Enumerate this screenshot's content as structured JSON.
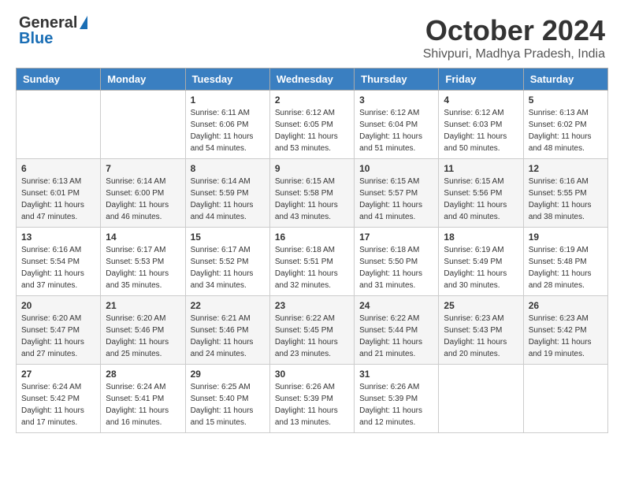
{
  "header": {
    "logo_general": "General",
    "logo_blue": "Blue",
    "month_title": "October 2024",
    "location": "Shivpuri, Madhya Pradesh, India"
  },
  "weekdays": [
    "Sunday",
    "Monday",
    "Tuesday",
    "Wednesday",
    "Thursday",
    "Friday",
    "Saturday"
  ],
  "weeks": [
    [
      {
        "day": "",
        "info": ""
      },
      {
        "day": "",
        "info": ""
      },
      {
        "day": "1",
        "info": "Sunrise: 6:11 AM\nSunset: 6:06 PM\nDaylight: 11 hours and 54 minutes."
      },
      {
        "day": "2",
        "info": "Sunrise: 6:12 AM\nSunset: 6:05 PM\nDaylight: 11 hours and 53 minutes."
      },
      {
        "day": "3",
        "info": "Sunrise: 6:12 AM\nSunset: 6:04 PM\nDaylight: 11 hours and 51 minutes."
      },
      {
        "day": "4",
        "info": "Sunrise: 6:12 AM\nSunset: 6:03 PM\nDaylight: 11 hours and 50 minutes."
      },
      {
        "day": "5",
        "info": "Sunrise: 6:13 AM\nSunset: 6:02 PM\nDaylight: 11 hours and 48 minutes."
      }
    ],
    [
      {
        "day": "6",
        "info": "Sunrise: 6:13 AM\nSunset: 6:01 PM\nDaylight: 11 hours and 47 minutes."
      },
      {
        "day": "7",
        "info": "Sunrise: 6:14 AM\nSunset: 6:00 PM\nDaylight: 11 hours and 46 minutes."
      },
      {
        "day": "8",
        "info": "Sunrise: 6:14 AM\nSunset: 5:59 PM\nDaylight: 11 hours and 44 minutes."
      },
      {
        "day": "9",
        "info": "Sunrise: 6:15 AM\nSunset: 5:58 PM\nDaylight: 11 hours and 43 minutes."
      },
      {
        "day": "10",
        "info": "Sunrise: 6:15 AM\nSunset: 5:57 PM\nDaylight: 11 hours and 41 minutes."
      },
      {
        "day": "11",
        "info": "Sunrise: 6:15 AM\nSunset: 5:56 PM\nDaylight: 11 hours and 40 minutes."
      },
      {
        "day": "12",
        "info": "Sunrise: 6:16 AM\nSunset: 5:55 PM\nDaylight: 11 hours and 38 minutes."
      }
    ],
    [
      {
        "day": "13",
        "info": "Sunrise: 6:16 AM\nSunset: 5:54 PM\nDaylight: 11 hours and 37 minutes."
      },
      {
        "day": "14",
        "info": "Sunrise: 6:17 AM\nSunset: 5:53 PM\nDaylight: 11 hours and 35 minutes."
      },
      {
        "day": "15",
        "info": "Sunrise: 6:17 AM\nSunset: 5:52 PM\nDaylight: 11 hours and 34 minutes."
      },
      {
        "day": "16",
        "info": "Sunrise: 6:18 AM\nSunset: 5:51 PM\nDaylight: 11 hours and 32 minutes."
      },
      {
        "day": "17",
        "info": "Sunrise: 6:18 AM\nSunset: 5:50 PM\nDaylight: 11 hours and 31 minutes."
      },
      {
        "day": "18",
        "info": "Sunrise: 6:19 AM\nSunset: 5:49 PM\nDaylight: 11 hours and 30 minutes."
      },
      {
        "day": "19",
        "info": "Sunrise: 6:19 AM\nSunset: 5:48 PM\nDaylight: 11 hours and 28 minutes."
      }
    ],
    [
      {
        "day": "20",
        "info": "Sunrise: 6:20 AM\nSunset: 5:47 PM\nDaylight: 11 hours and 27 minutes."
      },
      {
        "day": "21",
        "info": "Sunrise: 6:20 AM\nSunset: 5:46 PM\nDaylight: 11 hours and 25 minutes."
      },
      {
        "day": "22",
        "info": "Sunrise: 6:21 AM\nSunset: 5:46 PM\nDaylight: 11 hours and 24 minutes."
      },
      {
        "day": "23",
        "info": "Sunrise: 6:22 AM\nSunset: 5:45 PM\nDaylight: 11 hours and 23 minutes."
      },
      {
        "day": "24",
        "info": "Sunrise: 6:22 AM\nSunset: 5:44 PM\nDaylight: 11 hours and 21 minutes."
      },
      {
        "day": "25",
        "info": "Sunrise: 6:23 AM\nSunset: 5:43 PM\nDaylight: 11 hours and 20 minutes."
      },
      {
        "day": "26",
        "info": "Sunrise: 6:23 AM\nSunset: 5:42 PM\nDaylight: 11 hours and 19 minutes."
      }
    ],
    [
      {
        "day": "27",
        "info": "Sunrise: 6:24 AM\nSunset: 5:42 PM\nDaylight: 11 hours and 17 minutes."
      },
      {
        "day": "28",
        "info": "Sunrise: 6:24 AM\nSunset: 5:41 PM\nDaylight: 11 hours and 16 minutes."
      },
      {
        "day": "29",
        "info": "Sunrise: 6:25 AM\nSunset: 5:40 PM\nDaylight: 11 hours and 15 minutes."
      },
      {
        "day": "30",
        "info": "Sunrise: 6:26 AM\nSunset: 5:39 PM\nDaylight: 11 hours and 13 minutes."
      },
      {
        "day": "31",
        "info": "Sunrise: 6:26 AM\nSunset: 5:39 PM\nDaylight: 11 hours and 12 minutes."
      },
      {
        "day": "",
        "info": ""
      },
      {
        "day": "",
        "info": ""
      }
    ]
  ]
}
